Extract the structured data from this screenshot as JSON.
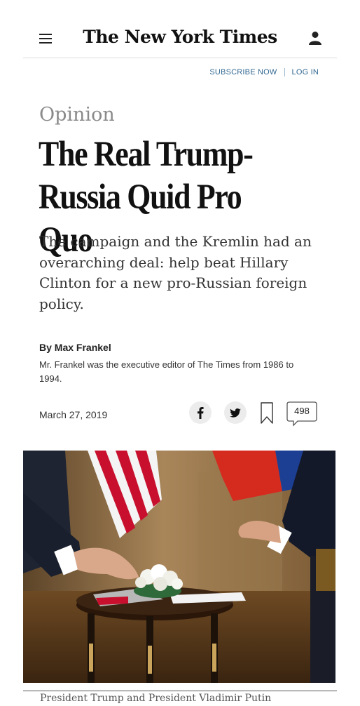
{
  "header": {
    "logo_text": "The New York Times",
    "subscribe_label": "SUBSCRIBE NOW",
    "login_label": "LOG IN",
    "accent_color": "#326891"
  },
  "article": {
    "section": "Opinion",
    "headline": "The Real Trump-Russia Quid Pro Quo",
    "summary": "The campaign and the Kremlin had an overarching deal: help beat Hillary Clinton for a new pro-Russian foreign policy.",
    "byline": "By Max Frankel",
    "bio": "Mr. Frankel was the executive editor of The Times from 1986 to 1994.",
    "date": "March 27, 2019",
    "comment_count": "498",
    "caption": "President Trump and President Vladimir Putin"
  },
  "icons": {
    "menu": "hamburger-icon",
    "user": "user-icon",
    "facebook": "facebook-icon",
    "twitter": "twitter-icon",
    "bookmark": "bookmark-icon",
    "comments": "comment-bubble-icon"
  }
}
